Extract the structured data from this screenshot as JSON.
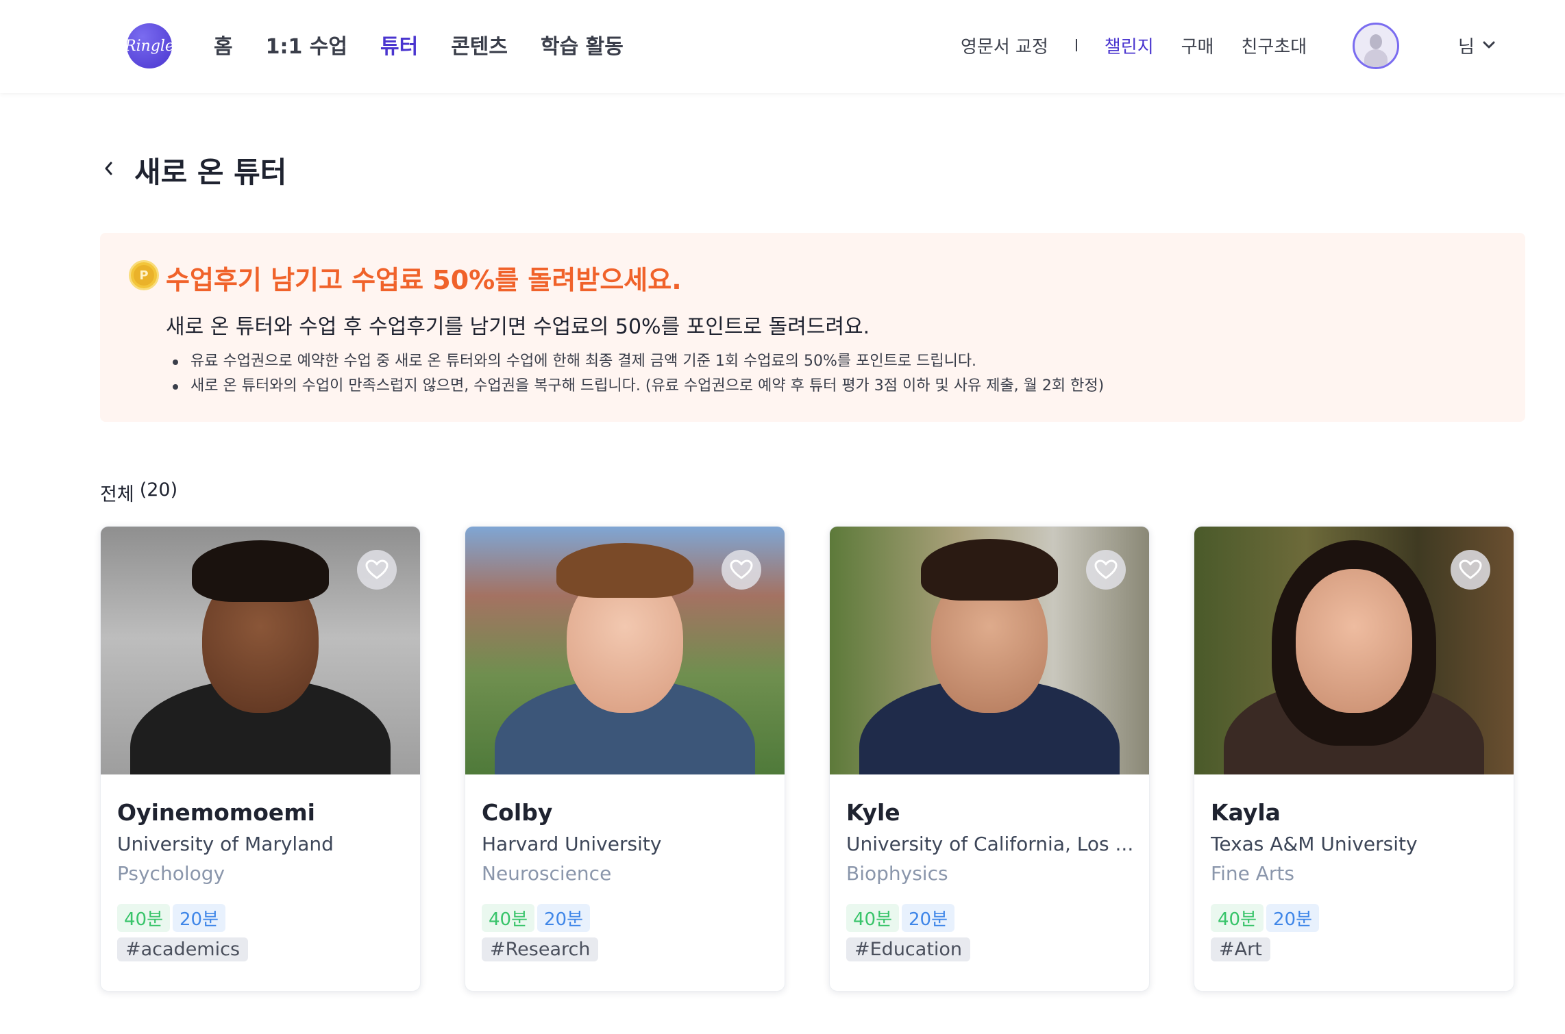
{
  "header": {
    "logo_text": "Ringle",
    "nav": [
      "홈",
      "1:1 수업",
      "튜터",
      "콘텐츠",
      "학습 활동"
    ],
    "active_nav": "튜터",
    "util": {
      "proofread": "영문서 교정",
      "challenge": "챌린지",
      "purchase": "구매",
      "invite": "친구초대"
    },
    "user_suffix": "님"
  },
  "page": {
    "title": "새로 온 튜터"
  },
  "banner": {
    "title": "수업후기 남기고 수업료 50%를 돌려받으세요.",
    "subtitle": "새로 온 튜터와 수업 후 수업후기를 남기면 수업료의 50%를 포인트로 돌려드려요.",
    "bullets": [
      "유료 수업권으로 예약한 수업 중 새로 온 튜터와의 수업에 한해 최종 결제 금액 기준 1회 수업료의 50%를 포인트로 드립니다.",
      "새로 온 튜터와의 수업이 만족스럽지 않으면, 수업권을 복구해 드립니다. (유료 수업권으로 예약 후 튜터 평가 3점 이하 및 사유 제출, 월 2회 한정)"
    ],
    "coin_glyph": "P"
  },
  "list": {
    "label": "전체",
    "count": "(20)"
  },
  "tutors": [
    {
      "name": "Oyinemomoemi",
      "school": "University of Maryland",
      "major": "Psychology",
      "lesson_long": "40분",
      "lesson_short": "20분",
      "tag": "#academics"
    },
    {
      "name": "Colby",
      "school": "Harvard University",
      "major": "Neuroscience",
      "lesson_long": "40분",
      "lesson_short": "20분",
      "tag": "#Research"
    },
    {
      "name": "Kyle",
      "school": "University of California, Los ...",
      "major": "Biophysics",
      "lesson_long": "40분",
      "lesson_short": "20분",
      "tag": "#Education"
    },
    {
      "name": "Kayla",
      "school": "Texas A&M University",
      "major": "Fine Arts",
      "lesson_long": "40분",
      "lesson_short": "20분",
      "tag": "#Art"
    }
  ],
  "colors": {
    "brand": "#4a35cf",
    "banner_accent": "#f0622a",
    "chip_green": "#38c46a",
    "chip_blue": "#3f86e8"
  },
  "icons": {
    "back": "chevron-left-icon",
    "favorite": "heart-outline-icon",
    "dropdown": "chevron-down-icon",
    "point": "point-coin-icon"
  }
}
